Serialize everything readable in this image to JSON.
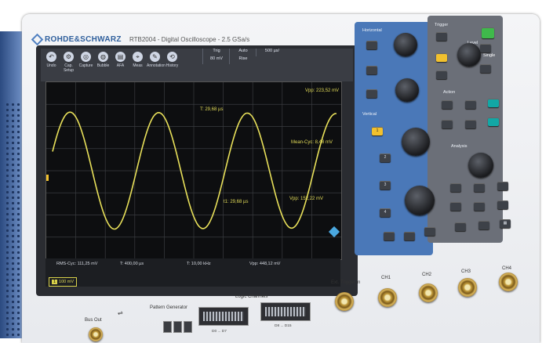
{
  "brand": {
    "name": "ROHDE&SCHWARZ",
    "model": "RTB2004 - Digital Oscilloscope - 2.5 GSa/s"
  },
  "toolbar": [
    "Undo",
    "Cap. Setup",
    "Capture",
    "Bubble",
    "AFA",
    "Meas",
    "Annotation",
    "History"
  ],
  "info_top": [
    {
      "label": "Trig",
      "value": "80 mV"
    },
    {
      "label": "Auto",
      "value": "Rise"
    },
    {
      "label": "500 µs/"
    }
  ],
  "plot": {
    "annotations": {
      "vpp": "Vpp: 223,52 mV",
      "period": "T: 29,68 µs",
      "mean": "Mean-Cyc: 8,48 mV",
      "vpp2": "Vpp: 152,22 mV",
      "cursor": "t1: 29,68 µs"
    }
  },
  "bottombar": {
    "row1": [
      "RMS-Cyc: 111,25 mV",
      "T: 400,00 µs",
      "T: 10,00 kHz",
      "Vpp: 448,12 mV"
    ],
    "ch1": {
      "key": "1",
      "scale": "100 mV"
    }
  },
  "panel": {
    "horizontal": "Horizontal",
    "vertical": "Vertical",
    "trigger": "Trigger",
    "action": "Action",
    "analysis": "Analysis",
    "level": "Level",
    "single": "Single"
  },
  "front": {
    "bus_out": "Bus Out",
    "pattern_generator": "Pattern Generator",
    "logic_channels": "Logic Channels",
    "ext_trigger": "Ext. Trigger In",
    "ch_labels": [
      "CH1",
      "CH2",
      "CH3",
      "CH4"
    ],
    "logic_ranges": [
      "D0 ... D7",
      "D8 ... D15"
    ]
  }
}
